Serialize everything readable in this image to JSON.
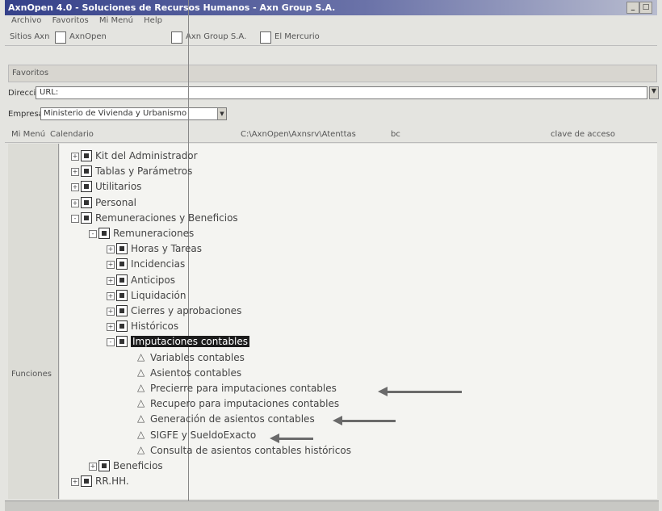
{
  "window": {
    "title": "AxnOpen 4.0 - Soluciones de Recursos Humanos - Axn Group S.A."
  },
  "menu": [
    "Archivo",
    "Favoritos",
    "Mi Menú",
    "Help"
  ],
  "links": {
    "label": "Sitios Axn",
    "items": [
      "AxnOpen",
      "Axn Group S.A.",
      "El Mercurio"
    ]
  },
  "favorites_label": "Favoritos",
  "address": {
    "label": "Dirección",
    "value": "URL:"
  },
  "empresa": {
    "label": "Empresa",
    "value": "Ministerio de Vivienda y Urbanismo"
  },
  "secondbar": {
    "mi_menu": "Mi Menú",
    "calendar": "Calendario",
    "path": "C:\\AxnOpen\\Axnsrv\\Atenttas",
    "bc": "bc",
    "key": "clave de acceso"
  },
  "sidebar": {
    "label": "Funciones"
  },
  "tree": [
    {
      "label": "Kit del Administrador",
      "level": 0,
      "exp": "+"
    },
    {
      "label": "Tablas y Parámetros",
      "level": 0,
      "exp": "+"
    },
    {
      "label": "Utilitarios",
      "level": 0,
      "exp": "+"
    },
    {
      "label": "Personal",
      "level": 0,
      "exp": "+"
    },
    {
      "label": "Remuneraciones y Beneficios",
      "level": 0,
      "exp": "-"
    },
    {
      "label": "Remuneraciones",
      "level": 1,
      "exp": "-"
    },
    {
      "label": "Horas y Tareas",
      "level": 2,
      "exp": "+"
    },
    {
      "label": "Incidencias",
      "level": 2,
      "exp": "+"
    },
    {
      "label": "Anticipos",
      "level": 2,
      "exp": "+"
    },
    {
      "label": "Liquidación",
      "level": 2,
      "exp": "+"
    },
    {
      "label": "Cierres y aprobaciones",
      "level": 2,
      "exp": "+"
    },
    {
      "label": "Históricos",
      "level": 2,
      "exp": "+"
    },
    {
      "label": "Imputaciones contables",
      "level": 2,
      "exp": "-",
      "selected": true
    }
  ],
  "leaves": [
    "Variables contables",
    "Asientos contables",
    "Precierre para imputaciones contables",
    "Recupero para imputaciones contables",
    "Generación de asientos contables",
    "SIGFE y SueldoExacto",
    "Consulta de asientos contables históricos"
  ],
  "tree_tail": [
    {
      "label": "Beneficios",
      "level": 1,
      "exp": "+"
    },
    {
      "label": "RR.HH.",
      "level": 0,
      "exp": "+"
    }
  ]
}
